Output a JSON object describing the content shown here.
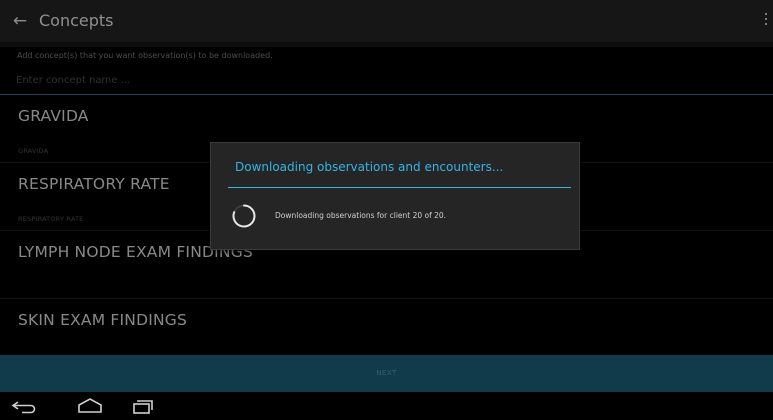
{
  "action_bar": {
    "title": "Concepts",
    "back_icon": "arrow-left-icon",
    "overflow_icon": "overflow-menu-icon"
  },
  "form": {
    "instruction": "Add concept(s) that you want observation(s) to be downloaded.",
    "search_placeholder": "Enter concept name ..."
  },
  "concepts": [
    {
      "name": "GRAVIDA",
      "subtitle": "GRAVIDA"
    },
    {
      "name": "RESPIRATORY RATE",
      "subtitle": "RESPIRATORY RATE"
    },
    {
      "name": "LYMPH NODE EXAM FINDINGS",
      "subtitle": ""
    },
    {
      "name": "SKIN EXAM FINDINGS",
      "subtitle": ""
    }
  ],
  "next_label": "NEXT",
  "dialog": {
    "title": "Downloading observations and encounters...",
    "message": "Downloading observations for client 20 of 20.",
    "accent_color": "#33b5e5"
  },
  "nav_bar": {
    "back_icon": "back-icon",
    "home_icon": "home-icon",
    "recents_icon": "recent-apps-icon"
  },
  "colors": {
    "accent": "#33b5e5",
    "next_button_bg": "#1b5a73",
    "action_bar_bg": "#222222"
  }
}
